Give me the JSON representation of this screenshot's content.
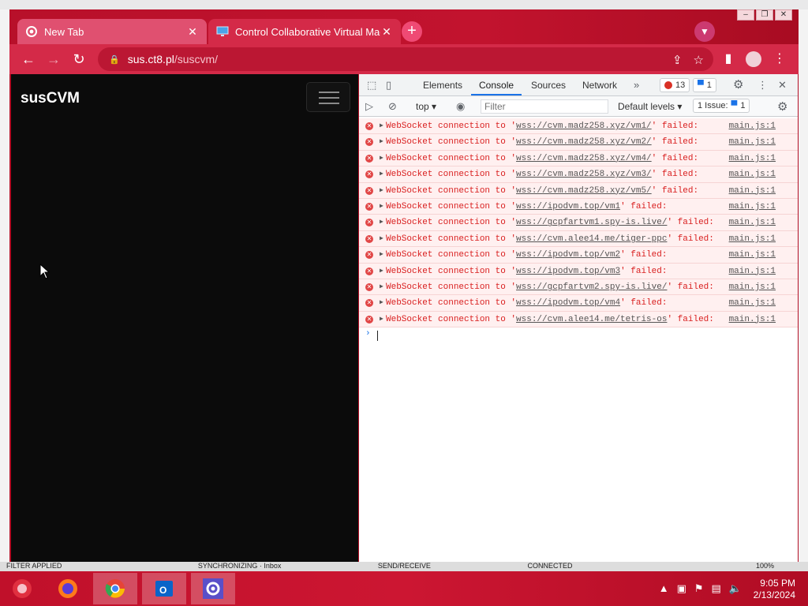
{
  "browser": {
    "tabs": [
      {
        "title": "New Tab",
        "icon": "chrome-icon",
        "active": false
      },
      {
        "title": "Control Collaborative Virtual Mac",
        "icon": "monitor-icon",
        "active": true
      }
    ],
    "address": {
      "host": "sus.ct8.pl",
      "path": "/suscvm/"
    }
  },
  "page": {
    "brand": "susCVM"
  },
  "devtools": {
    "tabs": [
      "Elements",
      "Console",
      "Sources",
      "Network"
    ],
    "active_tab": "Console",
    "error_count": "13",
    "message_count": "1",
    "context": "top",
    "filter_placeholder": "Filter",
    "levels": "Default levels",
    "issues_label": "1 Issue:",
    "issues_count": "1",
    "log": [
      {
        "prefix": "WebSocket connection to '",
        "url": "wss://cvm.madz258.xyz/vm1/",
        "suffix": "' failed:",
        "source": "main.js:1"
      },
      {
        "prefix": "WebSocket connection to '",
        "url": "wss://cvm.madz258.xyz/vm2/",
        "suffix": "' failed:",
        "source": "main.js:1"
      },
      {
        "prefix": "WebSocket connection to '",
        "url": "wss://cvm.madz258.xyz/vm4/",
        "suffix": "' failed:",
        "source": "main.js:1"
      },
      {
        "prefix": "WebSocket connection to '",
        "url": "wss://cvm.madz258.xyz/vm3/",
        "suffix": "' failed:",
        "source": "main.js:1"
      },
      {
        "prefix": "WebSocket connection to '",
        "url": "wss://cvm.madz258.xyz/vm5/",
        "suffix": "' failed:",
        "source": "main.js:1"
      },
      {
        "prefix": "WebSocket connection to '",
        "url": "wss://ipodvm.top/vm1",
        "suffix": "' failed:",
        "source": "main.js:1"
      },
      {
        "prefix": "WebSocket connection to '",
        "url": "wss://gcpfartvm1.spy-is.live/",
        "suffix": "' failed:",
        "source": "main.js:1"
      },
      {
        "prefix": "WebSocket connection to '",
        "url": "wss://cvm.alee14.me/tiger-ppc",
        "suffix": "' failed:",
        "source": "main.js:1"
      },
      {
        "prefix": "WebSocket connection to '",
        "url": "wss://ipodvm.top/vm2",
        "suffix": "' failed:",
        "source": "main.js:1"
      },
      {
        "prefix": "WebSocket connection to '",
        "url": "wss://ipodvm.top/vm3",
        "suffix": "' failed:",
        "source": "main.js:1"
      },
      {
        "prefix": "WebSocket connection to '",
        "url": "wss://gcpfartvm2.spy-is.live/",
        "suffix": "' failed:",
        "source": "main.js:1"
      },
      {
        "prefix": "WebSocket connection to '",
        "url": "wss://ipodvm.top/vm4",
        "suffix": "' failed:",
        "source": "main.js:1"
      },
      {
        "prefix": "WebSocket connection to '",
        "url": "wss://cvm.alee14.me/tetris-os",
        "suffix": "' failed:",
        "source": "main.js:1"
      }
    ]
  },
  "statusbar": {
    "items": [
      "FILTER APPLIED",
      "SYNCHRONIZING · Inbox",
      "SEND/RECEIVE",
      "CONNECTED",
      "100%"
    ]
  },
  "taskbar": {
    "apps": [
      "firefox-icon",
      "chrome-icon",
      "outlook-icon",
      "settings-icon"
    ],
    "time": "9:05 PM",
    "date": "2/13/2024"
  },
  "colors": {
    "accent": "#c8102e",
    "error": "#d92020",
    "devtools_tab_active": "#1a73e8"
  }
}
